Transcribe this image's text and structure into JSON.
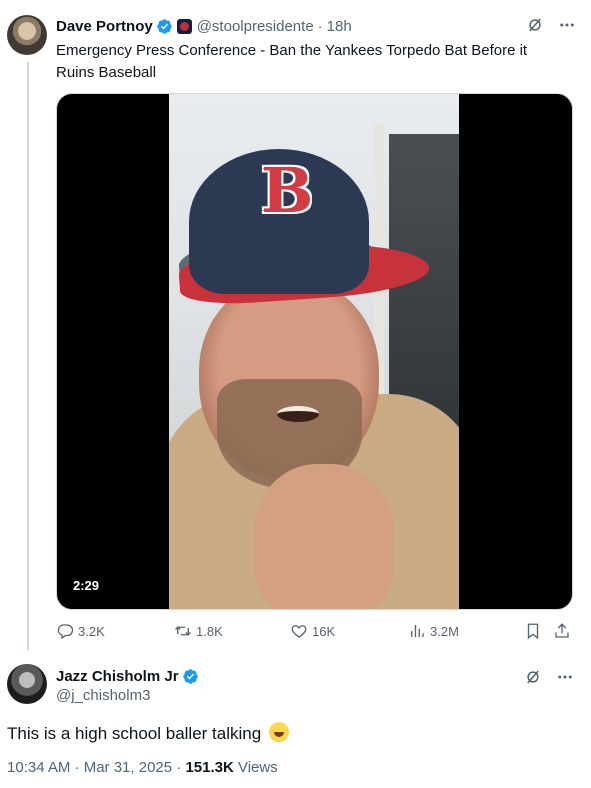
{
  "tweet": {
    "author_name": "Dave Portnoy",
    "handle": "@stoolpresidente",
    "separator": "·",
    "time": "18h",
    "text": "Emergency Press Conference - Ban the Yankees Torpedo Bat Before it Ruins Baseball",
    "video_duration": "2:29",
    "stats": {
      "replies": "3.2K",
      "reposts": "1.8K",
      "likes": "16K",
      "views": "3.2M"
    }
  },
  "reply": {
    "author_name": "Jazz Chisholm Jr",
    "handle": "@j_chisholm3",
    "text": "This is a high school baller talking",
    "timestamp": "10:34 AM · Mar 31, 2025 · ",
    "views_count": "151.3K",
    "views_label": " Views"
  },
  "colors": {
    "verified": "#1d9bf0",
    "secondary_text": "#536471",
    "primary_text": "#0f1419"
  },
  "icons": [
    "verified-badge-icon",
    "grok-icon",
    "more-icon",
    "reply-icon",
    "repost-icon",
    "like-icon",
    "views-icon",
    "bookmark-icon",
    "share-icon",
    "rofl-emoji-icon"
  ]
}
